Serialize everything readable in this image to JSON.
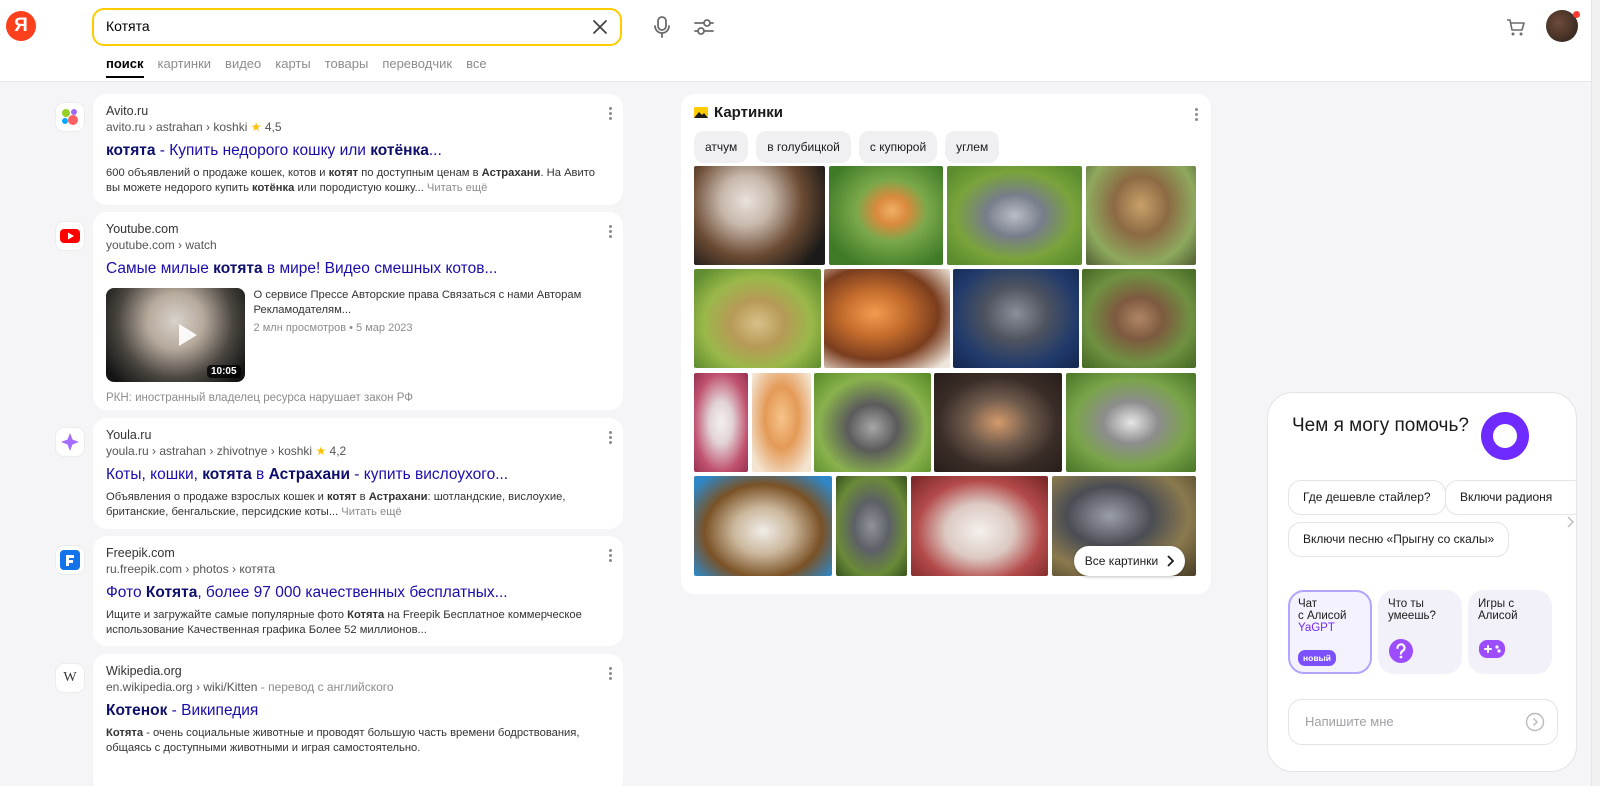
{
  "header": {
    "logo": "Я",
    "search_value": "Котята",
    "tabs": [
      "поиск",
      "картинки",
      "видео",
      "карты",
      "товары",
      "переводчик",
      "все"
    ]
  },
  "results": [
    {
      "site": "Avito.ru",
      "path": "avito.ru › astrahan › koshki",
      "rating": "4,5",
      "title_bold": "котята",
      "title_rest": " - Купить недорого кошку или ",
      "title_bold2": "котёнка",
      "title_end": "...",
      "snippet_1": "600 объявлений о продаже кошек, котов и ",
      "snippet_b1": "котят",
      "snippet_2": " по доступным ценам в ",
      "snippet_b2": "Астрахани",
      "snippet_3": ". На Авито вы можете недорого купить ",
      "snippet_b3": "котёнка",
      "snippet_4": " или породистую кошку... ",
      "more": "Читать ещё"
    },
    {
      "site": "Youtube.com",
      "path": "youtube.com › watch",
      "title_rest": "Самые милые ",
      "title_bold": "котята",
      "title_end": " в мире! Видео смешных котов...",
      "video_text": "О сервисе Прессе Авторские права Связаться с нами Авторам Рекламодателям...",
      "video_meta": "2 млн просмотров • 5 мар 2023",
      "duration": "10:05",
      "warning": "РКН: иностранный владелец ресурса нарушает закон РФ"
    },
    {
      "site": "Youla.ru",
      "path": "youla.ru › astrahan › zhivotnye › koshki",
      "rating": "4,2",
      "title_rest": "Коты, кошки, ",
      "title_bold": "котята",
      "title_mid": " в ",
      "title_bold2": "Астрахани",
      "title_end": " - купить вислоухого...",
      "snippet_1": "Объявления о продаже взрослых кошек и ",
      "snippet_b1": "котят",
      "snippet_2": " в ",
      "snippet_b2": "Астрахани",
      "snippet_3": ": шотландские, вислоухие, британские, бенгальские, персидские коты... ",
      "more": "Читать ещё"
    },
    {
      "site": "Freepik.com",
      "path": "ru.freepik.com › photos › котята",
      "title_rest": "Фото ",
      "title_bold": "Котята",
      "title_end": ", более 97 000 качественных бесплатных...",
      "snippet_1": "Ищите и загружайте самые популярные фото ",
      "snippet_b1": "Котята",
      "snippet_2": " на Freepik Бесплатное коммерческое использование Качественная графика Более 52 миллионов..."
    },
    {
      "site": "Wikipedia.org",
      "path": "en.wikipedia.org › wiki/Kitten",
      "path_note": " - перевод с английского",
      "title_bold": "Котенок",
      "title_end": " - Википедия",
      "snippet_b1": "Котята",
      "snippet_1": " - очень социальные животные и проводят большую часть времени бодрствования, общаясь с доступными животными и играя самостоятельно."
    }
  ],
  "images": {
    "title": "Картинки",
    "chips": [
      "атчум",
      "в голубицкой",
      "с купюрой",
      "углем"
    ],
    "all_label": "Все картинки"
  },
  "alice": {
    "question": "Чем я могу помочь?",
    "suggestions": [
      "Где дешевле стайлер?",
      "Включи радионя",
      "Включи песню «Прыгну со скалы»"
    ],
    "tile1_line1": "Чат",
    "tile1_line2": "с Алисой",
    "tile1_line3": "YaGPT",
    "tile1_badge": "новый",
    "tile2_line1": "Что ты",
    "tile2_line2": "умеешь?",
    "tile3_line1": "Игры с",
    "tile3_line2": "Алисой",
    "input_placeholder": "Напишите мне"
  },
  "colors": {
    "link": "#1a0dab",
    "accent_yellow": "#ffcc00",
    "alice_purple": "#6f2bff",
    "logo_red": "#fc3f1d"
  }
}
